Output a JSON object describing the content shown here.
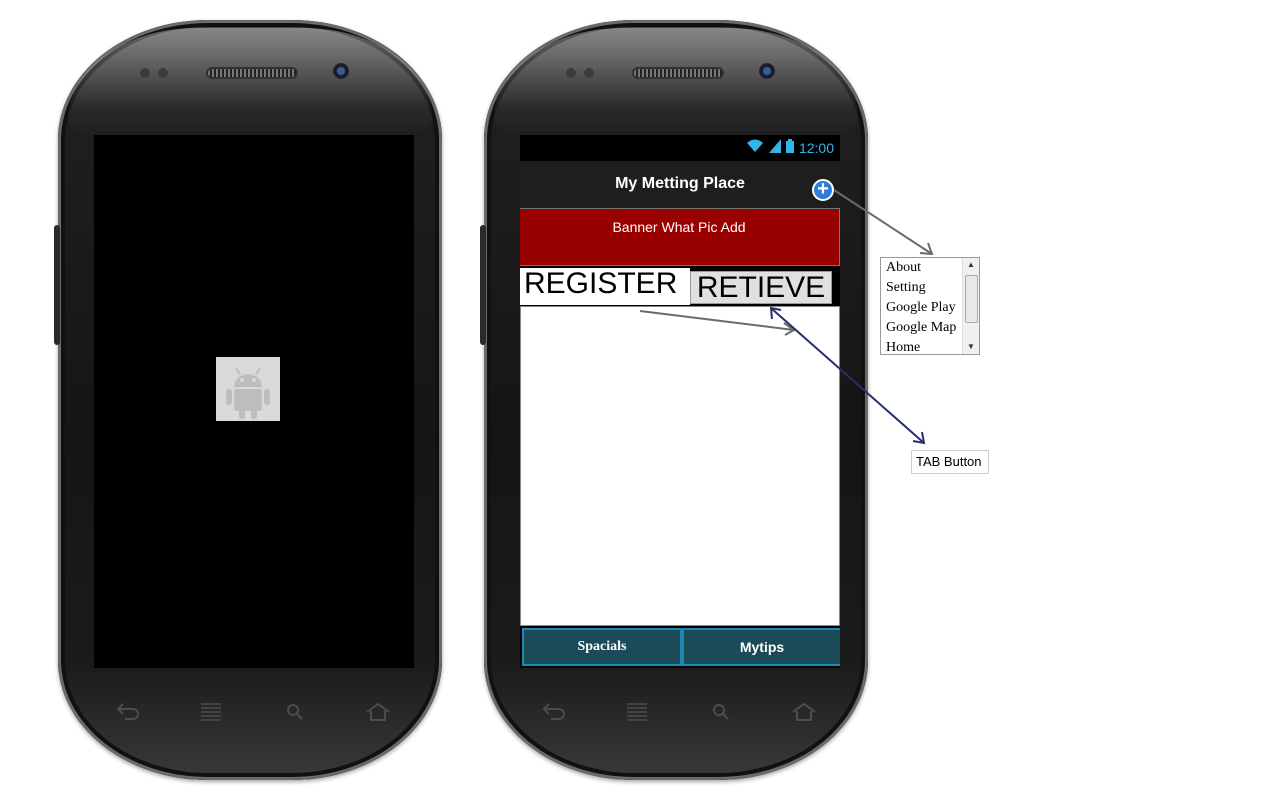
{
  "right_phone": {
    "status_time": "12:00",
    "app_title": "My Metting Place",
    "banner_text": "Banner What Pic Add",
    "tabs": [
      {
        "label": "REGISTER"
      },
      {
        "label": "RETIEVE"
      }
    ],
    "bottom_tabs": [
      {
        "label": "Spacials"
      },
      {
        "label": "Mytips"
      }
    ]
  },
  "annotations": {
    "menu_items": [
      "About",
      "Setting",
      "Google Play",
      "Google Map",
      "Home"
    ],
    "tab_button_label": "TAB Button"
  },
  "colors": {
    "banner": "#990000",
    "bottom_tab_bg": "#1b4a59",
    "bottom_tab_border": "#1e8ab3",
    "status_accent": "#33b5e5",
    "add_icon": "#2f7bd8"
  }
}
